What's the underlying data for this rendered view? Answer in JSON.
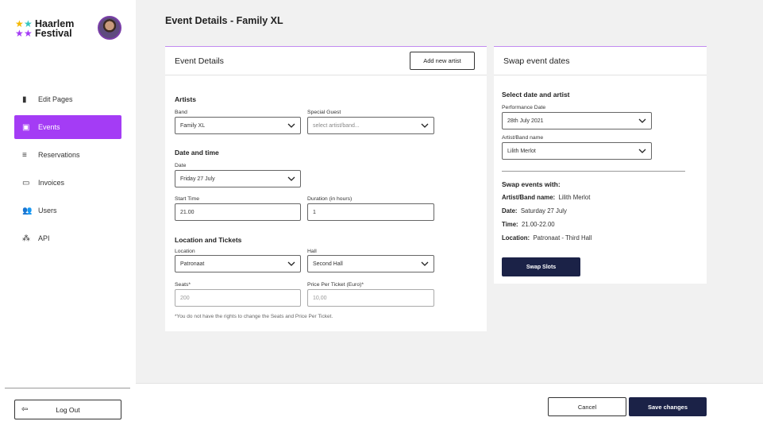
{
  "brand": {
    "line1": "Haarlem",
    "line2": "Festival",
    "star_colors": [
      "#f5b800",
      "#35c7c0",
      "#a43cf5",
      "#a43cf5"
    ]
  },
  "sidebar": {
    "items": [
      {
        "label": "Edit Pages",
        "icon": "book-icon"
      },
      {
        "label": "Events",
        "icon": "calendar-icon",
        "active": true
      },
      {
        "label": "Reservations",
        "icon": "list-icon"
      },
      {
        "label": "Invoices",
        "icon": "credit-card-icon"
      },
      {
        "label": "Users",
        "icon": "users-icon"
      },
      {
        "label": "API",
        "icon": "api-icon"
      }
    ],
    "logout_label": "Log Out"
  },
  "page": {
    "title": "Event Details - Family XL"
  },
  "details": {
    "title": "Event Details",
    "add_artist_label": "Add new artist",
    "artists_heading": "Artists",
    "band_label": "Band",
    "band_value": "Family XL",
    "guest_label": "Special Guest",
    "guest_placeholder": "select artist/band...",
    "datetime_heading": "Date and time",
    "date_label": "Date",
    "date_value": "Friday 27 July",
    "start_label": "Start Time",
    "start_value": "21.00",
    "duration_label": "Duration (in hours)",
    "duration_value": "1",
    "location_heading": "Location and Tickets",
    "location_label": "Location",
    "location_value": "Patronaat",
    "hall_label": "Hall",
    "hall_value": "Second Hall",
    "seats_label": "Seats*",
    "seats_value": "200",
    "price_label": "Price Per Ticket (Euro)*",
    "price_value": "10,00",
    "rights_note": "*You do not have the rights to change the Seats and Price Per Ticket."
  },
  "swap": {
    "title": "Swap event dates",
    "select_heading": "Select date and artist",
    "perf_date_label": "Performance Date",
    "perf_date_value": "28th July 2021",
    "artist_label": "Artist/Band name",
    "artist_value": "Lilith Merlot",
    "with_heading": "Swap events with:",
    "artist_key": "Artist/Band name:",
    "artist_val": "Lilith Merlot",
    "date_key": "Date:",
    "date_val": "Saturday 27 July",
    "time_key": "Time:",
    "time_val": "21.00-22.00",
    "loc_key": "Location:",
    "loc_val": "Patronaat  - Third Hall",
    "swap_button": "Swap Slots"
  },
  "footer": {
    "cancel_label": "Cancel",
    "save_label": "Save changes"
  },
  "colors": {
    "accent": "#a43cf5",
    "dark": "#1b2247"
  }
}
